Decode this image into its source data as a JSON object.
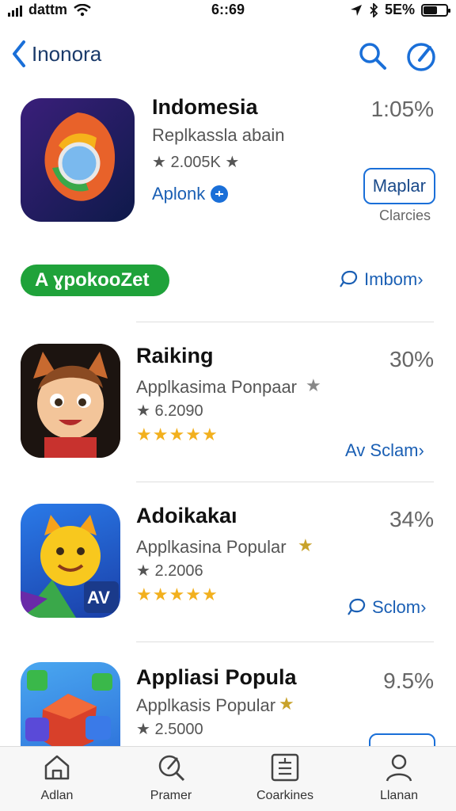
{
  "status": {
    "carrier": "dattm",
    "time": "6::69",
    "battery": "5E%",
    "battery_level": 0.55
  },
  "nav": {
    "back_label": "Inonora"
  },
  "featured": {
    "title": "Indomesia",
    "subtitle": "Replkassla abain",
    "rating": "★ 2.005K ★",
    "link_label": "Aplonk",
    "percent": "1:05%",
    "button_label": "Maplar",
    "caption": "Clarcies"
  },
  "banner": {
    "pill_label": "A ɣpokooZet",
    "link_label": "Imbom›"
  },
  "apps": [
    {
      "title": "Raiking",
      "subtitle": "Applkasima Ponpaar",
      "meta": "★ 6.2090",
      "rating": 4.5,
      "percent": "30%",
      "link_label": "Av Sclam›"
    },
    {
      "title": "Adoikakaı",
      "subtitle": "Applkasina Popular",
      "meta": "★ 2.2006",
      "rating": 4.5,
      "percent": "34%",
      "link_label": "Sclom›"
    },
    {
      "title": "Appliasi Popula",
      "subtitle": "Applkasis Popular",
      "meta": "★ 2.5000",
      "percent": "9.5%"
    }
  ],
  "tabs": [
    {
      "label": "Adlan",
      "icon": "home-icon"
    },
    {
      "label": "Pramer",
      "icon": "search-icon"
    },
    {
      "label": "Coarkines",
      "icon": "list-icon"
    },
    {
      "label": "Llanan",
      "icon": "person-icon"
    }
  ],
  "colors": {
    "accent": "#1a6fd8",
    "banner": "#1fa23a",
    "star": "#f2b01e"
  }
}
